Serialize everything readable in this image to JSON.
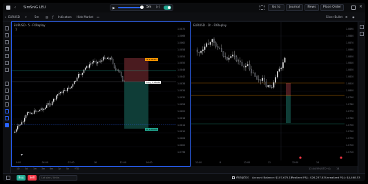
{
  "titlebar": {
    "workspace": "SimSniG LEU",
    "replay_speed": "5m",
    "goto": "Go to",
    "journal": "Journal",
    "news": "News",
    "place_order": "Place Order"
  },
  "toolbar": {
    "symbol": "EURUSD",
    "interval": "5m",
    "indicators": "Indicators",
    "hide_market": "Hide Market",
    "theme": "Silver Bullet"
  },
  "left_chart": {
    "title": "EURUSD · 5 · FXReplay",
    "sub": "1",
    "price_labels": [
      "1.0870",
      "1.0866",
      "1.0862",
      "1.0858",
      "1.0854",
      "1.0850",
      "1.0846",
      "1.0842",
      "1.0838",
      "1.0834",
      "1.0830",
      "1.0826",
      "1.0822",
      "1.0818",
      "1.0814",
      "1.0810",
      "1.0806",
      "1.0802",
      "1.0798"
    ],
    "time_labels": [
      "0:00",
      "04:00",
      "07:00",
      "16",
      "12:00",
      "16:00"
    ],
    "zoom_buttons": [
      "1D",
      "5d",
      "1m",
      "3m",
      "6m",
      "1y",
      "5y",
      "YTD"
    ],
    "order_labels": {
      "tp": "TP  1.08421",
      "entry": "Entry  1.08262",
      "sl": "SL  1.08008"
    }
  },
  "right_chart": {
    "title": "EURUSD · 1h · FXReplay",
    "price_labels": [
      "1.0890",
      "1.0880",
      "1.0870",
      "1.0860",
      "1.0850",
      "1.0840",
      "1.0830",
      "1.0820",
      "1.0810",
      "1.0800",
      "1.0790",
      "1.0780",
      "1.0770",
      "1.0760",
      "1.0750",
      "1.0740",
      "1.0730",
      "1.0720",
      "1.0710"
    ],
    "time_labels": [
      "12:00",
      "8",
      "12:00",
      "11",
      "12:00",
      "14"
    ],
    "timestamp": "12:44:59 (UTC+4)",
    "time_info": "14"
  },
  "bottom": {
    "buy": "Buy",
    "sell": "Sell",
    "input_placeholder": "Lot size / Units",
    "analytics": "Analytics",
    "account_balance": "Account Balance: $107,675.15",
    "realized": "Realized P&L: $26,237.83",
    "unrealized": "Unrealized P&L: $4,468.53"
  },
  "colors": {
    "accent": "#2962ff",
    "buy": "#22ab94",
    "sell": "#f23645",
    "tp_zone": "#0f3d37",
    "sl_zone": "#4a1b1f",
    "orange": "#ff9800"
  }
}
